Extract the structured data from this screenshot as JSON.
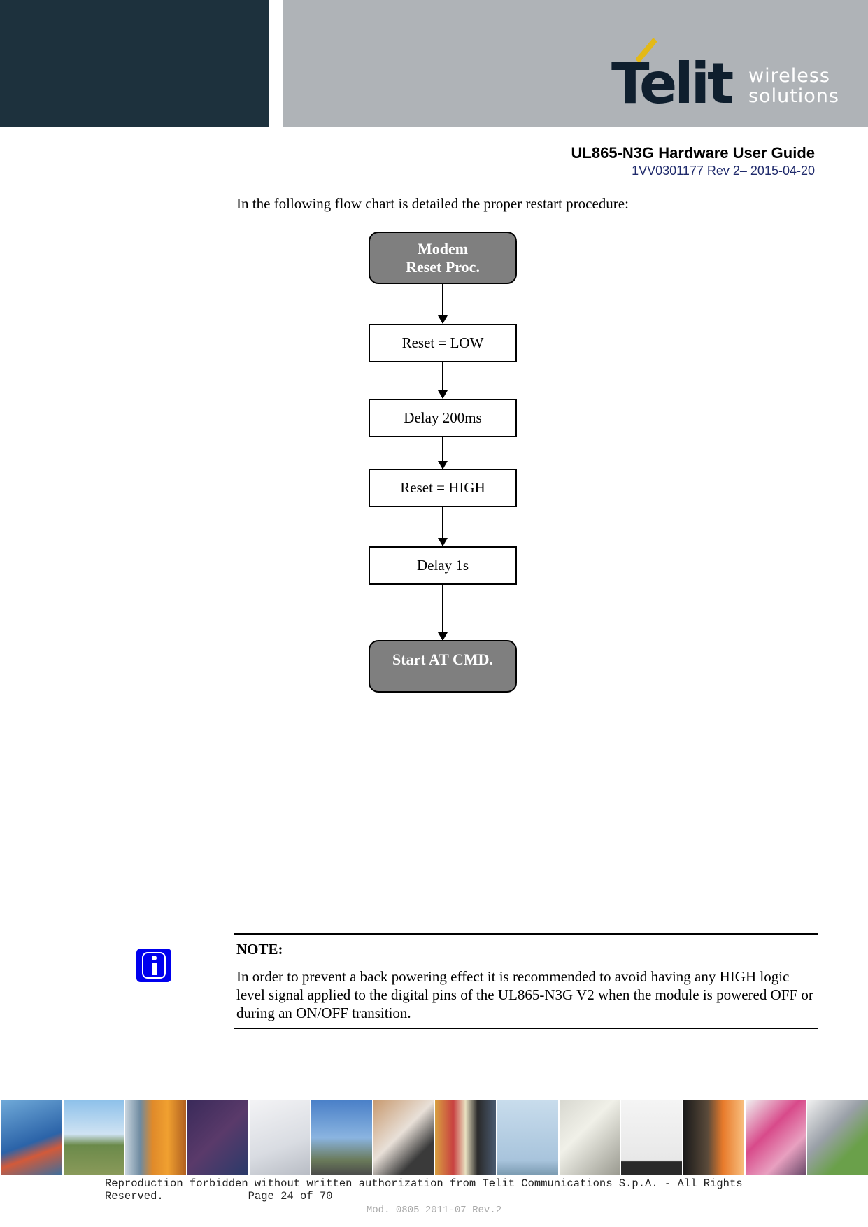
{
  "header": {
    "brand": "Telit",
    "tagline_line1": "wireless",
    "tagline_line2": "solutions",
    "doc_title": "UL865-N3G Hardware User Guide",
    "doc_ref": "1VV0301177 Rev 2– 2015-04-20",
    "colors": {
      "dark_panel": "#1d313d",
      "gray_panel": "#afb3b7",
      "accent": "#e3b917"
    }
  },
  "body": {
    "intro": "In the following flow chart is detailed the proper restart procedure:"
  },
  "flowchart": {
    "nodes": [
      {
        "type": "terminator",
        "text": "Modem Reset Proc."
      },
      {
        "type": "process",
        "text": "Reset = LOW"
      },
      {
        "type": "process",
        "text": "Delay 200ms"
      },
      {
        "type": "process",
        "text": "Reset = HIGH"
      },
      {
        "type": "process",
        "text": "Delay 1s"
      },
      {
        "type": "terminator",
        "text": "Start AT CMD."
      }
    ]
  },
  "note": {
    "icon": "info-icon",
    "label": "NOTE:",
    "text": "In order to prevent a back powering effect it is recommended to avoid having any HIGH logic level signal applied to the digital pins of the UL865-N3G V2 when the module is powered OFF or during an ON/OFF transition."
  },
  "footer": {
    "strip_tiles": [
      "highway-traffic",
      "sos-phone",
      "shipping-containers",
      "departure-board",
      "keyboard",
      "cyclist",
      "card-reader",
      "vending-machine",
      "wind-turbines",
      "electricity-meter",
      "window-frame",
      "train-station",
      "printing",
      "security-camera"
    ],
    "line1": "Reproduction forbidden without written authorization from Telit Communications S.p.A. - All Rights",
    "line2": "Reserved.             Page 24 of 70",
    "mod": "Mod. 0805 2011-07 Rev.2"
  }
}
